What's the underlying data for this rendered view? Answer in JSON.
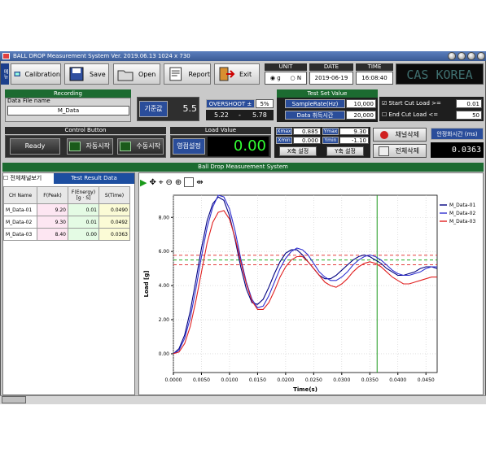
{
  "window": {
    "title": "BALL DROP Measurement System  Ver. 2019.06.13  1024 x 730"
  },
  "side_label": "메뉴",
  "toolbar": {
    "calibration": "Calibration",
    "save": "Save",
    "open": "Open",
    "report": "Report",
    "exit": "Exit"
  },
  "unit": {
    "label": "UNIT",
    "opt_g": "g",
    "opt_n": "N",
    "selected": "g"
  },
  "date": {
    "label": "DATE",
    "value": "2019-06-19"
  },
  "time": {
    "label": "TIME",
    "value": "16:08:40"
  },
  "brand": "CAS KOREA",
  "recording": {
    "title": "Recording",
    "file_label": "Data File name",
    "file_value": "M_Data"
  },
  "standard": {
    "label": "기준값",
    "value": "5.5"
  },
  "overshoot": {
    "label": "OVERSHOOT ±",
    "pct": "5%",
    "low": "5.22",
    "dash": "-",
    "high": "5.78"
  },
  "test_set": {
    "title": "Test Set Value",
    "rate_label": "SampleRate(Hz)",
    "rate_value": "10,000",
    "acq_label": "Data 취득시간",
    "acq_value": "20,000"
  },
  "cut": {
    "start_label": "Start Cut Load >=",
    "start_value": "0.01",
    "end_label": "End   Cut Load <=",
    "end_value": "50"
  },
  "control": {
    "title": "Control Button",
    "ready": "Ready",
    "auto": "자동시작",
    "manual": "수동시작"
  },
  "load": {
    "title": "Load Value",
    "zero_btn": "영점설정",
    "value": "0.00"
  },
  "axes": {
    "xmax_label": "Xmax",
    "xmax_value": "0.885",
    "ymax_label": "Ymax",
    "ymax_value": "9.30",
    "xmin_label": "Xmin",
    "xmin_value": "0.000",
    "ymin_label": "Ymin",
    "ymin_value": "-1.10",
    "x_btn": "X축 설정",
    "y_btn": "Y축 설정"
  },
  "actions": {
    "delete_ch": "채널삭제",
    "delete_all": "전체삭제"
  },
  "stabilize": {
    "label": "안정화시간 (ms)",
    "value": "0.0363"
  },
  "graph_title": "Ball Drop Measurement System",
  "tabs": {
    "all": "전체채널보기",
    "result": "Test Result Data"
  },
  "table": {
    "headers": [
      "CH Name",
      "F(Peak)",
      "F(Energy)\n[g · S]",
      "S(Time)"
    ],
    "rows": [
      [
        "M_Data-01",
        "9.20",
        "0.01",
        "0.0490"
      ],
      [
        "M_Data-02",
        "9.30",
        "0.01",
        "0.0492"
      ],
      [
        "M_Data-03",
        "8.40",
        "0.00",
        "0.0363"
      ]
    ]
  },
  "colors": {
    "series1": "#000080",
    "series2": "#3030d0",
    "series3": "#e02020",
    "green_header": "#1c6b31",
    "blue_label": "#2a4d9a"
  },
  "chart_data": {
    "type": "line",
    "xlabel": "Time(s)",
    "ylabel": "Load [g]",
    "xlim": [
      0,
      0.047
    ],
    "ylim": [
      -1.1,
      9.3
    ],
    "xticks": [
      "0.0000",
      "0.0050",
      "0.0100",
      "0.0150",
      "0.0200",
      "0.0250",
      "0.0300",
      "0.0350",
      "0.0400",
      "0.0450"
    ],
    "yticks": [
      "0.00",
      "2.00",
      "4.00",
      "6.00",
      "8.00"
    ],
    "legend_position": "top-right",
    "series": [
      {
        "name": "M_Data-01",
        "color": "#000080",
        "x": [
          0,
          0.001,
          0.002,
          0.003,
          0.004,
          0.005,
          0.006,
          0.007,
          0.008,
          0.009,
          0.01,
          0.011,
          0.012,
          0.013,
          0.014,
          0.015,
          0.016,
          0.017,
          0.018,
          0.019,
          0.02,
          0.021,
          0.022,
          0.023,
          0.024,
          0.025,
          0.026,
          0.027,
          0.028,
          0.029,
          0.03,
          0.031,
          0.032,
          0.033,
          0.034,
          0.035,
          0.036,
          0.037,
          0.038,
          0.039,
          0.04,
          0.041,
          0.042,
          0.043,
          0.044,
          0.045,
          0.046,
          0.047
        ],
        "y": [
          0,
          0.3,
          1.1,
          2.5,
          4.3,
          6.2,
          7.8,
          8.8,
          9.2,
          9.0,
          8.1,
          6.7,
          5.1,
          3.8,
          3.0,
          2.9,
          3.2,
          3.9,
          4.7,
          5.4,
          5.9,
          6.1,
          6.1,
          5.8,
          5.4,
          5.0,
          4.6,
          4.4,
          4.4,
          4.6,
          4.9,
          5.2,
          5.5,
          5.7,
          5.8,
          5.7,
          5.5,
          5.3,
          5.0,
          4.8,
          4.6,
          4.6,
          4.7,
          4.8,
          5.0,
          5.1,
          5.1,
          5.0
        ]
      },
      {
        "name": "M_Data-02",
        "color": "#3030d0",
        "x": [
          0,
          0.001,
          0.002,
          0.003,
          0.004,
          0.005,
          0.006,
          0.007,
          0.008,
          0.009,
          0.01,
          0.011,
          0.012,
          0.013,
          0.014,
          0.015,
          0.016,
          0.017,
          0.018,
          0.019,
          0.02,
          0.021,
          0.022,
          0.023,
          0.024,
          0.025,
          0.026,
          0.027,
          0.028,
          0.029,
          0.03,
          0.031,
          0.032,
          0.033,
          0.034,
          0.035,
          0.036,
          0.037,
          0.038,
          0.039,
          0.04,
          0.041,
          0.042,
          0.043,
          0.044,
          0.045,
          0.046,
          0.047
        ],
        "y": [
          0,
          0.2,
          0.9,
          2.1,
          3.8,
          5.7,
          7.4,
          8.6,
          9.3,
          9.2,
          8.5,
          7.2,
          5.6,
          4.2,
          3.2,
          2.7,
          2.8,
          3.4,
          4.2,
          5.0,
          5.6,
          6.0,
          6.2,
          6.1,
          5.8,
          5.3,
          4.8,
          4.5,
          4.3,
          4.3,
          4.5,
          4.8,
          5.2,
          5.5,
          5.7,
          5.8,
          5.7,
          5.5,
          5.2,
          4.9,
          4.7,
          4.6,
          4.6,
          4.7,
          4.8,
          5.0,
          5.1,
          5.1
        ]
      },
      {
        "name": "M_Data-03",
        "color": "#e02020",
        "x": [
          0,
          0.001,
          0.002,
          0.003,
          0.004,
          0.005,
          0.006,
          0.007,
          0.008,
          0.009,
          0.01,
          0.011,
          0.012,
          0.013,
          0.014,
          0.015,
          0.016,
          0.017,
          0.018,
          0.019,
          0.02,
          0.021,
          0.022,
          0.023,
          0.024,
          0.025,
          0.026,
          0.027,
          0.028,
          0.029,
          0.03,
          0.031,
          0.032,
          0.033,
          0.034,
          0.035,
          0.036,
          0.037,
          0.038,
          0.039,
          0.04,
          0.041,
          0.042,
          0.043,
          0.044,
          0.045,
          0.046,
          0.047
        ],
        "y": [
          0,
          0.1,
          0.6,
          1.6,
          3.1,
          4.8,
          6.5,
          7.7,
          8.3,
          8.4,
          7.9,
          6.8,
          5.4,
          4.1,
          3.1,
          2.6,
          2.6,
          3.0,
          3.7,
          4.5,
          5.1,
          5.5,
          5.7,
          5.7,
          5.4,
          5.0,
          4.6,
          4.2,
          4.0,
          3.9,
          4.1,
          4.4,
          4.8,
          5.1,
          5.3,
          5.4,
          5.3,
          5.1,
          4.8,
          4.5,
          4.3,
          4.1,
          4.1,
          4.2,
          4.3,
          4.4,
          4.5,
          4.5
        ]
      }
    ],
    "hlines": [
      {
        "y": 5.78,
        "color": "#e02020",
        "dashed": true
      },
      {
        "y": 5.5,
        "color": "#00a000",
        "dashed": true
      },
      {
        "y": 5.22,
        "color": "#e02020",
        "dashed": true
      }
    ],
    "cursor_x": 0.0363
  }
}
